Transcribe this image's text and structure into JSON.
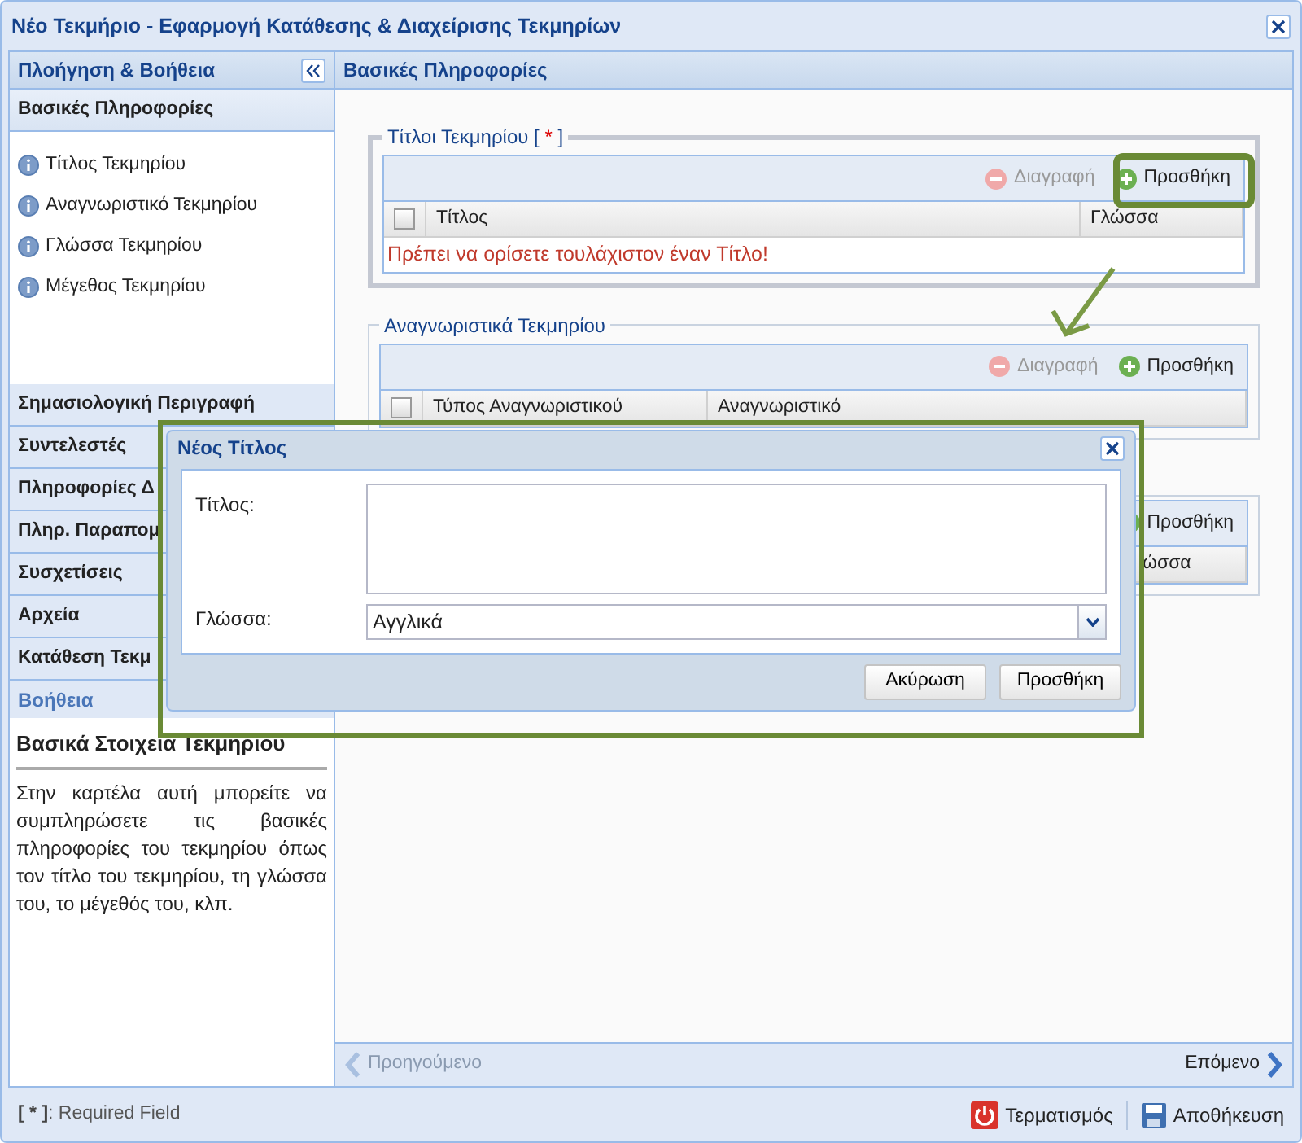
{
  "window": {
    "title": "Νέο Τεκμήριο - Εφαρμογή Κατάθεσης & Διαχείρισης Τεκμηρίων"
  },
  "nav_panel": {
    "title": "Πλοήγηση & Βοήθεια",
    "sections": [
      {
        "label": "Βασικές Πληροφορίες",
        "expanded": true,
        "items": [
          "Τίτλος Τεκμηρίου",
          "Αναγνωριστικό Τεκμηρίου",
          "Γλώσσα Τεκμηρίου",
          "Μέγεθος Τεκμηρίου"
        ]
      },
      {
        "label": "Σημασιολογική Περιγραφή",
        "expanded": false
      },
      {
        "label": "Συντελεστές",
        "expanded": false
      },
      {
        "label": "Πληροφορίες Δ",
        "expanded": false
      },
      {
        "label": "Πληρ. Παραπομ",
        "expanded": false
      },
      {
        "label": "Συσχετίσεις",
        "expanded": false
      },
      {
        "label": "Αρχεία",
        "expanded": false
      },
      {
        "label": "Κατάθεση Τεκμ",
        "expanded": false
      }
    ],
    "help": {
      "header": "Βοήθεια",
      "title": "Βασικά Στοιχεία Τεκμηρίου",
      "text": "Στην καρτέλα αυτή μπορείτε να συμπληρώσετε τις βασικές πληροφορίες του τεκμηρίου όπως τον τίτλο του τεκμηρίου, τη γλώσσα του, το μέγεθός του, κλπ."
    }
  },
  "main": {
    "header": "Βασικές Πληροφορίες",
    "fieldsets": [
      {
        "legend_parts": [
          "Τίτλοι Τεκμηρίου [ ",
          "*",
          " ]"
        ],
        "active": true,
        "select_all_checked": false,
        "tools": [
          {
            "kind": "delete",
            "label": "Διαγραφή",
            "disabled": true
          },
          {
            "kind": "add",
            "label": "Προσθήκη",
            "disabled": false
          }
        ],
        "columns": [
          "Τίτλος",
          "Γλώσσα"
        ],
        "message": "Πρέπει να ορίσετε τουλάχιστον έναν Τίτλο!"
      },
      {
        "legend_parts": [
          "Αναγνωριστικά Τεκμηρίου"
        ],
        "active": false,
        "select_all_checked": false,
        "tools": [
          {
            "kind": "delete",
            "label": "Διαγραφή",
            "disabled": true
          },
          {
            "kind": "add",
            "label": "Προσθήκη",
            "disabled": false
          }
        ],
        "columns": [
          "Τύπος Αναγνωριστικού",
          "Αναγνωριστικό"
        ]
      },
      {
        "active": false,
        "tools": [
          {
            "kind": "add",
            "label": "Προσθήκη",
            "disabled": false
          }
        ],
        "columns": [
          "ώσσα"
        ]
      }
    ],
    "previous": {
      "label": "Προηγούμενο",
      "disabled": true
    },
    "next": {
      "label": "Επόμενο",
      "disabled": false
    }
  },
  "footer": {
    "note_parts": [
      "[ ",
      "*",
      " ]",
      ": Required Field"
    ],
    "actions": [
      {
        "kind": "power",
        "label": "Τερματισμός"
      },
      {
        "kind": "save",
        "label": "Αποθήκευση"
      }
    ]
  },
  "dialog": {
    "title": "Νέος Τίτλος",
    "fields": [
      {
        "kind": "textarea",
        "label": "Τίτλος:"
      },
      {
        "kind": "select",
        "label": "Γλώσσα:",
        "value": "Αγγλικά"
      }
    ],
    "buttons": [
      "Ακύρωση",
      "Προσθήκη"
    ]
  }
}
